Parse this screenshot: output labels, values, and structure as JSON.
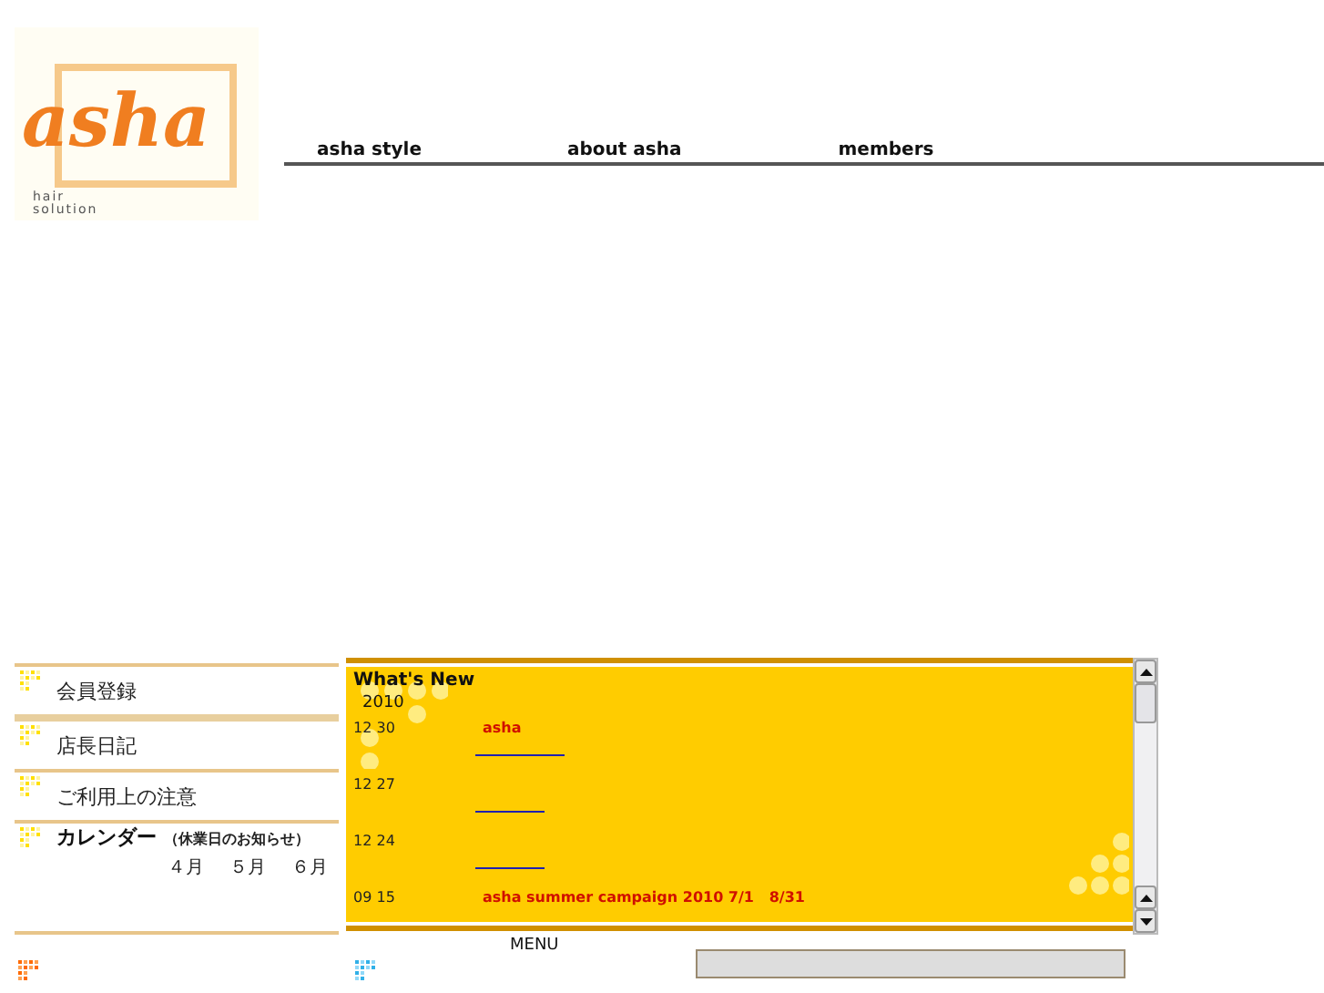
{
  "logo": {
    "word": "asha",
    "lines": [
      "hair",
      "solution"
    ]
  },
  "nav": [
    {
      "label": "asha style"
    },
    {
      "label": "about asha"
    },
    {
      "label": "members"
    }
  ],
  "side_menu": [
    {
      "kind": "link",
      "label": "会員登録"
    },
    {
      "kind": "link",
      "label": "店長日記"
    },
    {
      "kind": "link",
      "label": "ご利用上の注意"
    },
    {
      "kind": "calendar",
      "label": "カレンダー",
      "note": "（休業日のお知らせ）",
      "months": [
        "４月",
        "５月",
        "６月"
      ]
    }
  ],
  "news": {
    "title": "What's New",
    "year": "2010",
    "entries": [
      {
        "date": "12 30",
        "text": "asha",
        "link_line": true
      },
      {
        "date": "12 27",
        "link_line": true
      },
      {
        "date": "12 24",
        "link_line": true
      },
      {
        "date": "09 15",
        "text": "asha summer campaign 2010 7/1   8/31",
        "link_line": false
      }
    ]
  },
  "menu_label": "MENU"
}
